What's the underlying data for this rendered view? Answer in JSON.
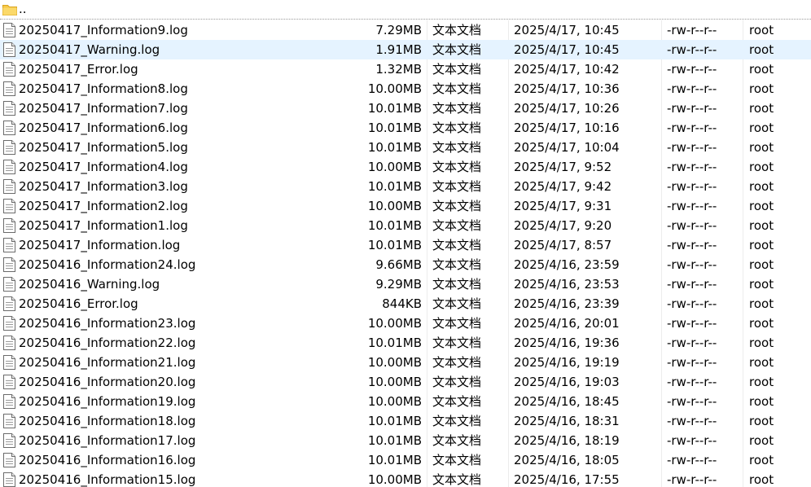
{
  "parent_dir": {
    "label": "..",
    "icon": "folder-icon"
  },
  "file_icon": "file-icon",
  "colors": {
    "folder": "#f7c948",
    "selected_row": "#e5f3ff"
  },
  "rows": [
    {
      "name": "20250417_Information9.log",
      "size": "7.29MB",
      "type": "文本文档",
      "modified": "2025/4/17, 10:45",
      "permissions": "-rw-r--r--",
      "owner": "root"
    },
    {
      "name": "20250417_Warning.log",
      "size": "1.91MB",
      "type": "文本文档",
      "modified": "2025/4/17, 10:45",
      "permissions": "-rw-r--r--",
      "owner": "root",
      "selected": true
    },
    {
      "name": "20250417_Error.log",
      "size": "1.32MB",
      "type": "文本文档",
      "modified": "2025/4/17, 10:42",
      "permissions": "-rw-r--r--",
      "owner": "root"
    },
    {
      "name": "20250417_Information8.log",
      "size": "10.00MB",
      "type": "文本文档",
      "modified": "2025/4/17, 10:36",
      "permissions": "-rw-r--r--",
      "owner": "root"
    },
    {
      "name": "20250417_Information7.log",
      "size": "10.01MB",
      "type": "文本文档",
      "modified": "2025/4/17, 10:26",
      "permissions": "-rw-r--r--",
      "owner": "root"
    },
    {
      "name": "20250417_Information6.log",
      "size": "10.01MB",
      "type": "文本文档",
      "modified": "2025/4/17, 10:16",
      "permissions": "-rw-r--r--",
      "owner": "root"
    },
    {
      "name": "20250417_Information5.log",
      "size": "10.01MB",
      "type": "文本文档",
      "modified": "2025/4/17, 10:04",
      "permissions": "-rw-r--r--",
      "owner": "root"
    },
    {
      "name": "20250417_Information4.log",
      "size": "10.00MB",
      "type": "文本文档",
      "modified": "2025/4/17, 9:52",
      "permissions": "-rw-r--r--",
      "owner": "root"
    },
    {
      "name": "20250417_Information3.log",
      "size": "10.01MB",
      "type": "文本文档",
      "modified": "2025/4/17, 9:42",
      "permissions": "-rw-r--r--",
      "owner": "root"
    },
    {
      "name": "20250417_Information2.log",
      "size": "10.00MB",
      "type": "文本文档",
      "modified": "2025/4/17, 9:31",
      "permissions": "-rw-r--r--",
      "owner": "root"
    },
    {
      "name": "20250417_Information1.log",
      "size": "10.01MB",
      "type": "文本文档",
      "modified": "2025/4/17, 9:20",
      "permissions": "-rw-r--r--",
      "owner": "root"
    },
    {
      "name": "20250417_Information.log",
      "size": "10.01MB",
      "type": "文本文档",
      "modified": "2025/4/17, 8:57",
      "permissions": "-rw-r--r--",
      "owner": "root"
    },
    {
      "name": "20250416_Information24.log",
      "size": "9.66MB",
      "type": "文本文档",
      "modified": "2025/4/16, 23:59",
      "permissions": "-rw-r--r--",
      "owner": "root"
    },
    {
      "name": "20250416_Warning.log",
      "size": "9.29MB",
      "type": "文本文档",
      "modified": "2025/4/16, 23:53",
      "permissions": "-rw-r--r--",
      "owner": "root"
    },
    {
      "name": "20250416_Error.log",
      "size": "844KB",
      "type": "文本文档",
      "modified": "2025/4/16, 23:39",
      "permissions": "-rw-r--r--",
      "owner": "root"
    },
    {
      "name": "20250416_Information23.log",
      "size": "10.00MB",
      "type": "文本文档",
      "modified": "2025/4/16, 20:01",
      "permissions": "-rw-r--r--",
      "owner": "root"
    },
    {
      "name": "20250416_Information22.log",
      "size": "10.01MB",
      "type": "文本文档",
      "modified": "2025/4/16, 19:36",
      "permissions": "-rw-r--r--",
      "owner": "root"
    },
    {
      "name": "20250416_Information21.log",
      "size": "10.00MB",
      "type": "文本文档",
      "modified": "2025/4/16, 19:19",
      "permissions": "-rw-r--r--",
      "owner": "root"
    },
    {
      "name": "20250416_Information20.log",
      "size": "10.00MB",
      "type": "文本文档",
      "modified": "2025/4/16, 19:03",
      "permissions": "-rw-r--r--",
      "owner": "root"
    },
    {
      "name": "20250416_Information19.log",
      "size": "10.00MB",
      "type": "文本文档",
      "modified": "2025/4/16, 18:45",
      "permissions": "-rw-r--r--",
      "owner": "root"
    },
    {
      "name": "20250416_Information18.log",
      "size": "10.01MB",
      "type": "文本文档",
      "modified": "2025/4/16, 18:31",
      "permissions": "-rw-r--r--",
      "owner": "root"
    },
    {
      "name": "20250416_Information17.log",
      "size": "10.01MB",
      "type": "文本文档",
      "modified": "2025/4/16, 18:19",
      "permissions": "-rw-r--r--",
      "owner": "root"
    },
    {
      "name": "20250416_Information16.log",
      "size": "10.01MB",
      "type": "文本文档",
      "modified": "2025/4/16, 18:05",
      "permissions": "-rw-r--r--",
      "owner": "root"
    },
    {
      "name": "20250416_Information15.log",
      "size": "10.00MB",
      "type": "文本文档",
      "modified": "2025/4/16, 17:55",
      "permissions": "-rw-r--r--",
      "owner": "root"
    }
  ]
}
